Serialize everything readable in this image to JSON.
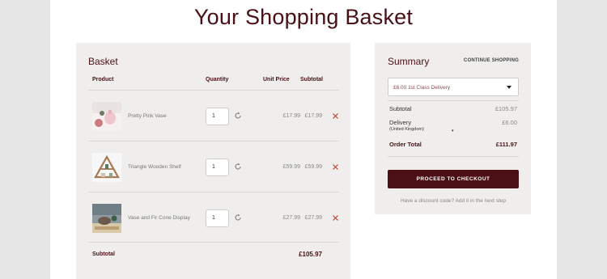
{
  "page_title": "Your Shopping Basket",
  "basket": {
    "title": "Basket",
    "headers": {
      "product": "Product",
      "quantity": "Quantity",
      "unit_price": "Unit Price",
      "subtotal": "Subtotal"
    },
    "items": [
      {
        "name": "Pretty Pink Vase",
        "quantity": "1",
        "unit_price": "£17.99",
        "subtotal": "£17.99"
      },
      {
        "name": "Triangle Wooden Shelf",
        "quantity": "1",
        "unit_price": "£59.99",
        "subtotal": "£59.99"
      },
      {
        "name": "Vase and Fir Cone Display",
        "quantity": "1",
        "unit_price": "£27.99",
        "subtotal": "£27.99"
      }
    ],
    "subtotal_label": "Subtotal",
    "subtotal_value": "£105.97"
  },
  "summary": {
    "title": "Summary",
    "continue_label": "CONTINUE SHOPPING",
    "delivery_option": "£6.00 1st Class Delivery",
    "subtotal_label": "Subtotal",
    "subtotal_value": "£105.97",
    "delivery_label": "Delivery",
    "delivery_value": "£6.00",
    "country": "United Kingdom",
    "order_total_label": "Order Total",
    "order_total_value": "£111.97",
    "checkout_label": "PROCEED TO CHECKOUT",
    "discount_text": "Have a discount code? Add it in the next step"
  },
  "colors": {
    "brand": "#4a1015",
    "remove": "#c0392b",
    "panel": "#efeeec"
  },
  "icons": {
    "refresh": "refresh-icon",
    "remove": "close-icon",
    "dropdown": "chevron-down-icon"
  }
}
